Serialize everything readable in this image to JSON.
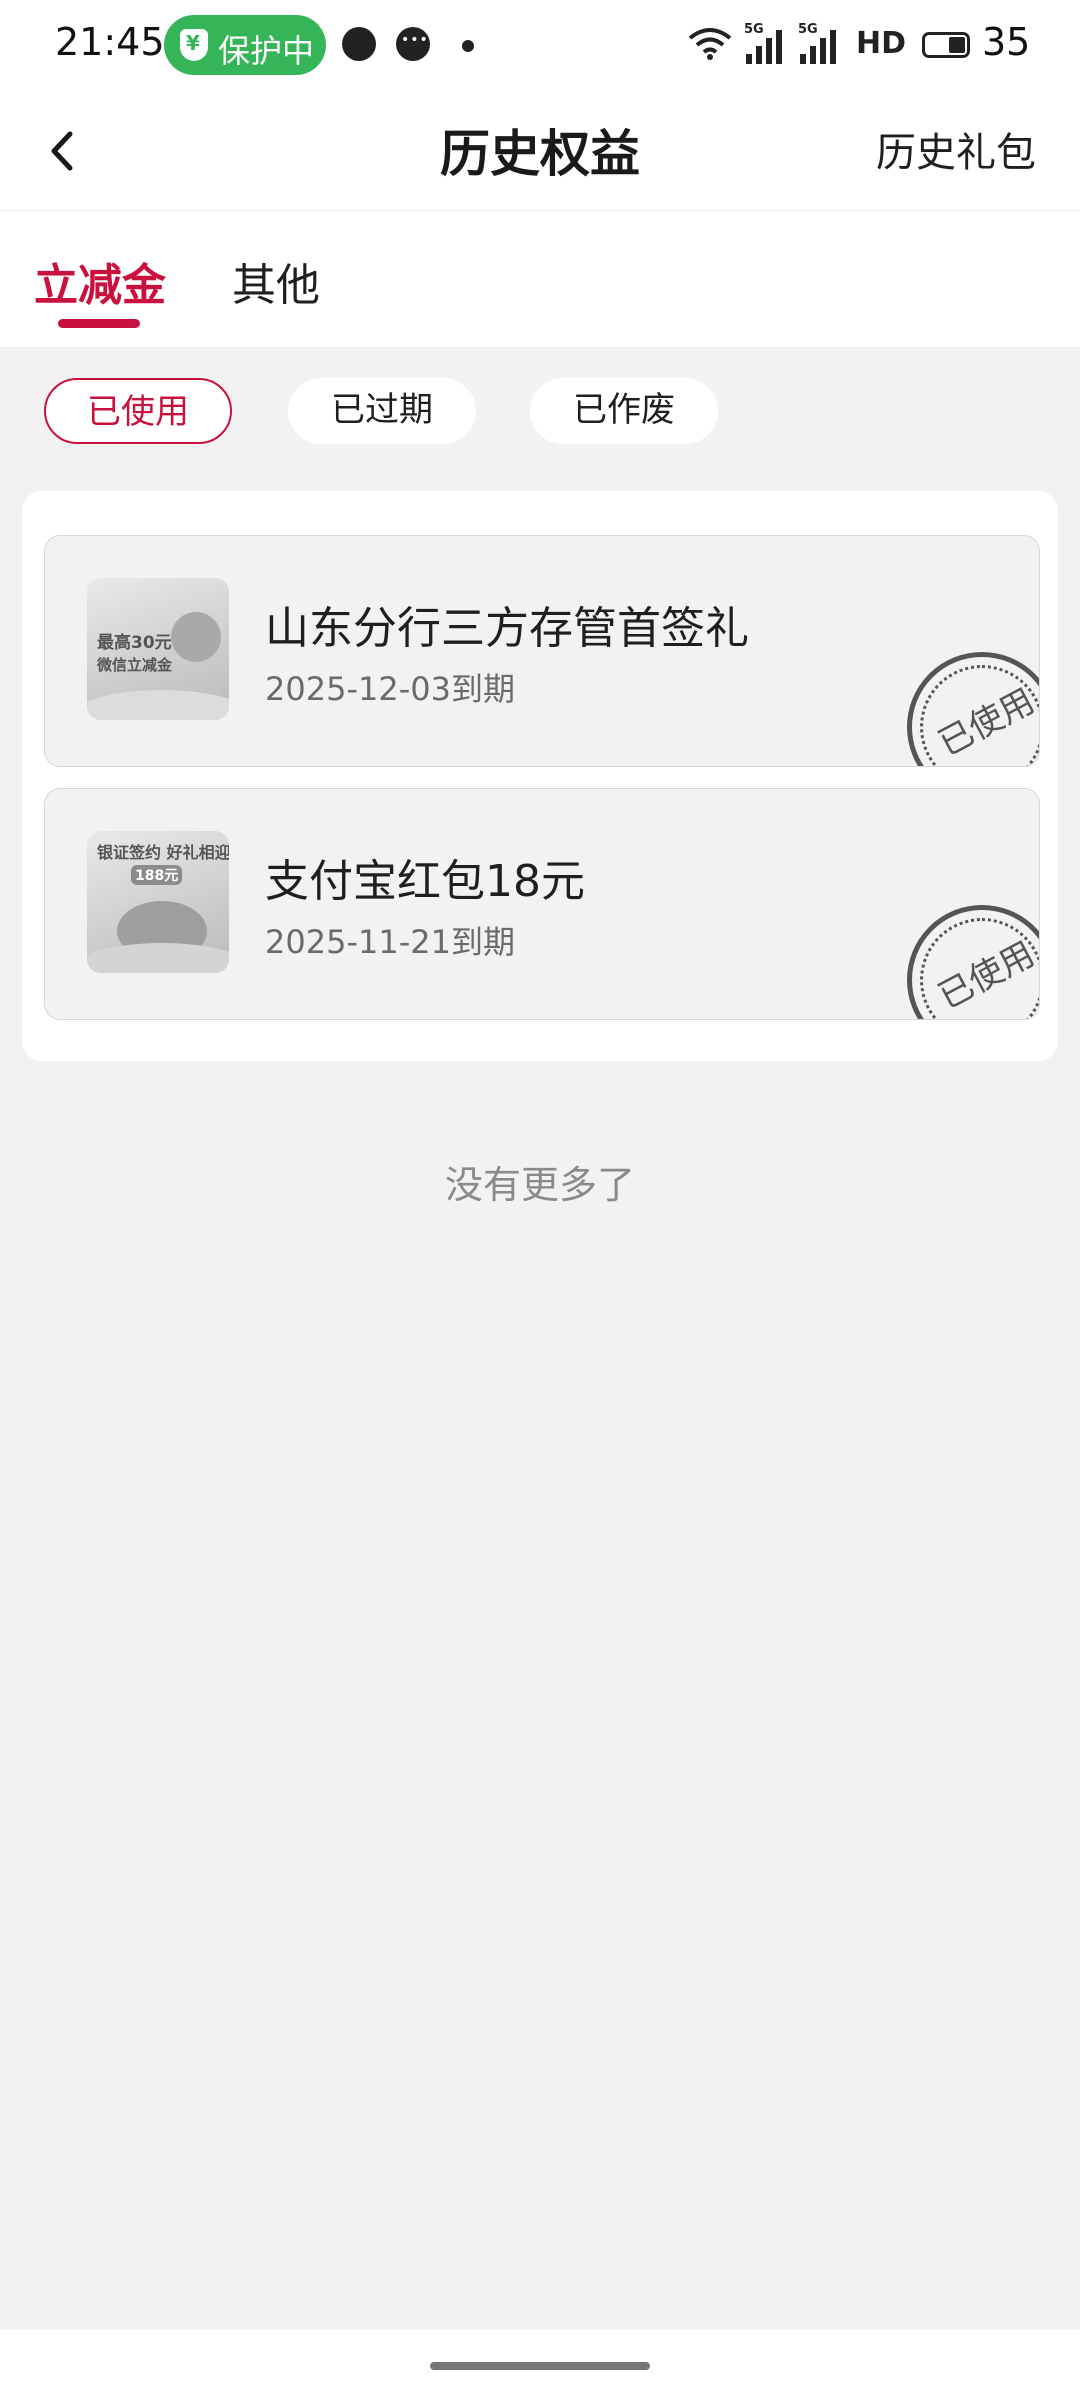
{
  "status_bar": {
    "time": "21:45",
    "protect_label": "保护中",
    "network_tag_1": "5G",
    "network_tag_2": "5G",
    "hd_label": "HD",
    "battery_level": "35"
  },
  "nav": {
    "title": "历史权益",
    "right_link": "历史礼包"
  },
  "tabs": [
    {
      "label": "立减金",
      "active": true
    },
    {
      "label": "其他",
      "active": false
    }
  ],
  "filters": [
    {
      "label": "已使用",
      "active": true
    },
    {
      "label": "已过期",
      "active": false
    },
    {
      "label": "已作废",
      "active": false
    }
  ],
  "coupons": [
    {
      "title": "山东分行三方存管首签礼",
      "expiry": "2025-12-03到期",
      "stamp": "已使用",
      "thumb_line_1": "最高30元",
      "thumb_line_2": "微信立减金"
    },
    {
      "title": "支付宝红包18元",
      "expiry": "2025-11-21到期",
      "stamp": "已使用",
      "thumb_line_1": "银证签约 好礼相迎",
      "thumb_line_2": "188元"
    }
  ],
  "footer_text": "没有更多了",
  "colors": {
    "accent": "#c8123d",
    "protect_green": "#35b558",
    "page_bg": "#f2f2f2"
  }
}
